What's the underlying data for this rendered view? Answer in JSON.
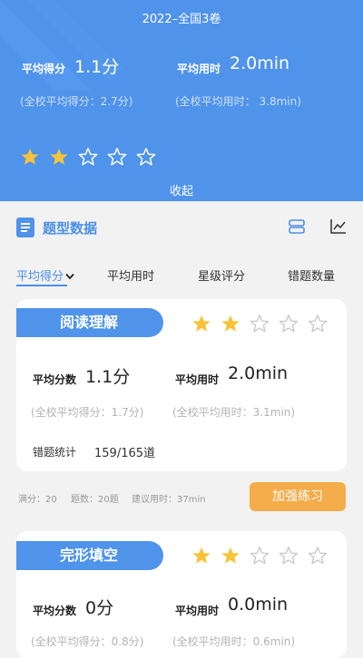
{
  "header": {
    "exam_title": "2022–全国3卷",
    "avg_score_label": "平均得分",
    "avg_score_value": "1.1分",
    "avg_time_label": "平均用时",
    "avg_time_value": "2.0min",
    "school_avg_score": "(全校平均得分：2.7分)",
    "school_avg_time": "(全校平均用时： 3.8min)",
    "rating_stars": 2,
    "rating_max": 5,
    "collapse_label": "收起"
  },
  "section": {
    "title": "题型数据",
    "icon": "document-icon",
    "view_icons": [
      "list-view-icon",
      "line-chart-icon"
    ]
  },
  "sort_tabs": [
    {
      "label": "平均得分",
      "active": true,
      "icon": "chevron-down-icon"
    },
    {
      "label": "平均用时",
      "active": false
    },
    {
      "label": "星级评分",
      "active": false
    },
    {
      "label": "错题数量",
      "active": false
    }
  ],
  "cards": [
    {
      "title": "阅读理解",
      "stars": 2,
      "avg_score_label": "平均分数",
      "avg_score_value": "1.1分",
      "avg_time_label": "平均用时",
      "avg_time_value": "2.0min",
      "school_avg_score": "(全校平均得分：1.7分)",
      "school_avg_time": "(全校平均用时：3.1min)",
      "errors_label": "错题统计",
      "errors_value": "159/165道",
      "full_score": "满分：20",
      "question_count": "题数：20题",
      "suggested_time": "建议用时：37min",
      "practice_label": "加强练习"
    },
    {
      "title": "完形填空",
      "stars": 2,
      "avg_score_label": "平均分数",
      "avg_score_value": "0分",
      "avg_time_label": "平均用时",
      "avg_time_value": "0.0min",
      "school_avg_score": "(全校平均得分：0.8分)",
      "school_avg_time": "(全校平均用时：0.6min)"
    }
  ],
  "colors": {
    "primary": "#4f93ea",
    "star_filled": "#f6c33a",
    "practice_button": "#f5ac4a"
  }
}
